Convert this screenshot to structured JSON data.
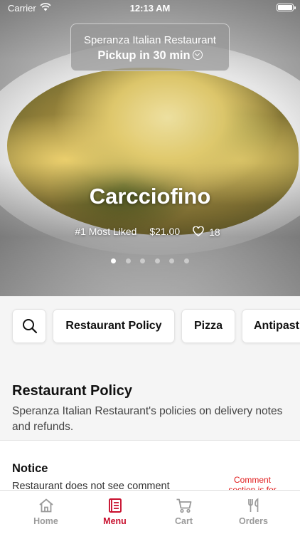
{
  "status": {
    "carrier": "Carrier",
    "time": "12:13 AM"
  },
  "pickup": {
    "restaurant": "Speranza Italian Restaurant",
    "eta": "Pickup in 30 min"
  },
  "featured": {
    "title": "Carcciofino",
    "badge": "#1 Most Liked",
    "price": "$21.00",
    "likes": "18",
    "slides": 6,
    "active_slide": 1
  },
  "categories": [
    "Restaurant Policy",
    "Pizza",
    "Antipasti"
  ],
  "section": {
    "title": "Restaurant Policy",
    "description": "Speranza Italian Restaurant's policies on delivery notes and refunds."
  },
  "notice": {
    "title": "Notice",
    "text": "Restaurant does not see comment",
    "side_note": "Comment section is for"
  },
  "tabs": [
    {
      "label": "Home",
      "icon": "home-icon"
    },
    {
      "label": "Menu",
      "icon": "menu-icon"
    },
    {
      "label": "Cart",
      "icon": "cart-icon"
    },
    {
      "label": "Orders",
      "icon": "utensils-icon"
    }
  ],
  "active_tab": "Menu",
  "colors": {
    "accent": "#c8102e",
    "tab_inactive": "#9a9a9a",
    "background": "#f5f5f5"
  }
}
